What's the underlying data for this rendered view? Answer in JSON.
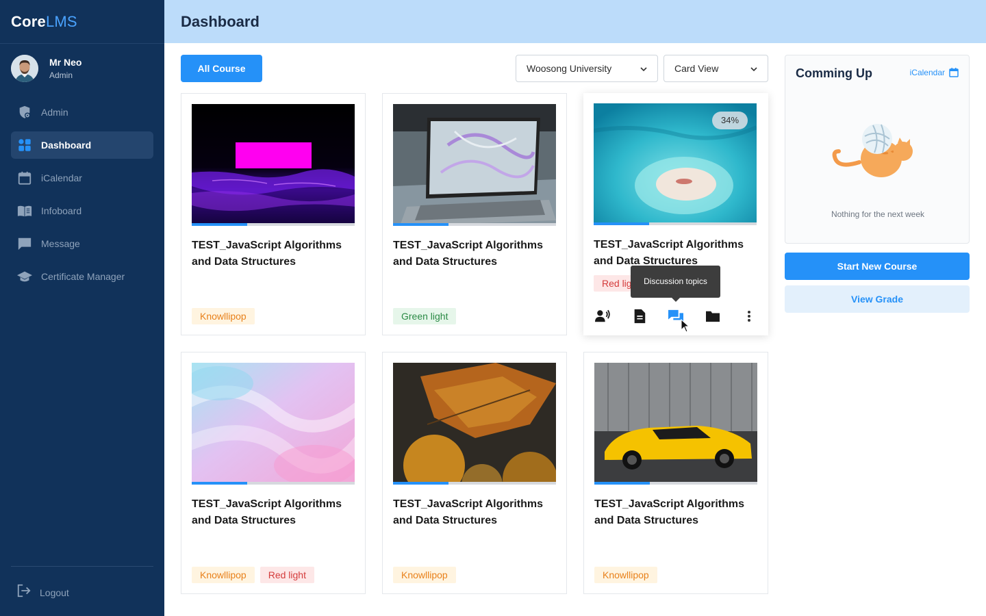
{
  "app": {
    "logo_main": "Core",
    "logo_accent": "LMS"
  },
  "user": {
    "name": "Mr Neo",
    "role": "Admin"
  },
  "sidebar": {
    "items": [
      {
        "label": "Admin",
        "icon": "admin-icon",
        "active": false
      },
      {
        "label": "Dashboard",
        "icon": "dashboard-grid-icon",
        "active": true
      },
      {
        "label": "iCalendar",
        "icon": "calendar-icon",
        "active": false
      },
      {
        "label": "Infoboard",
        "icon": "book-icon",
        "active": false
      },
      {
        "label": "Message",
        "icon": "message-icon",
        "active": false
      },
      {
        "label": "Certificate Manager",
        "icon": "graduation-cap-icon",
        "active": false
      }
    ],
    "logout_label": "Logout"
  },
  "header": {
    "title": "Dashboard"
  },
  "toolbar": {
    "all_course_label": "All Course",
    "university_select": "Woosong University",
    "view_select": "Card View"
  },
  "courses": [
    {
      "title": "TEST_JavaScript Algorithms and Data Structures",
      "progress": 0.34,
      "tags": [
        {
          "label": "Knowllipop",
          "color": "orange"
        }
      ],
      "image": "neon-water"
    },
    {
      "title": "TEST_JavaScript Algorithms and Data Structures",
      "progress": 0.34,
      "tags": [
        {
          "label": "Green light",
          "color": "green"
        }
      ],
      "image": "laptop"
    },
    {
      "title": "TEST_JavaScript Algorithms and Data Structures",
      "progress": 0.34,
      "progress_label": "34%",
      "tags": [
        {
          "label": "Red light",
          "color": "red"
        }
      ],
      "image": "island",
      "hovered": true
    },
    {
      "title": "TEST_JavaScript Algorithms and Data Structures",
      "progress": 0.34,
      "tags": [
        {
          "label": "Knowllipop",
          "color": "orange"
        },
        {
          "label": "Red light",
          "color": "red"
        }
      ],
      "image": "holographic"
    },
    {
      "title": "TEST_JavaScript Algorithms and Data Structures",
      "progress": 0.34,
      "tags": [
        {
          "label": "Knowllipop",
          "color": "orange"
        }
      ],
      "image": "autumn-leaf"
    },
    {
      "title": "TEST_JavaScript Algorithms and Data Structures",
      "progress": 0.34,
      "tags": [
        {
          "label": "Knowllipop",
          "color": "orange"
        }
      ],
      "image": "yellow-car"
    }
  ],
  "card_actions": {
    "icons": [
      "attendance-icon",
      "document-icon",
      "discussion-icon",
      "folder-icon",
      "more-vertical-icon"
    ],
    "tooltip": "Discussion topics"
  },
  "upcoming": {
    "title": "Comming Up",
    "calendar_link": "iCalendar",
    "empty_message": "Nothing for the next week"
  },
  "actions": {
    "start_new_course": "Start New Course",
    "view_grade": "View Grade"
  },
  "colors": {
    "primary": "#2591f8",
    "sidebar": "#11325a",
    "header": "#bcdcfa"
  }
}
